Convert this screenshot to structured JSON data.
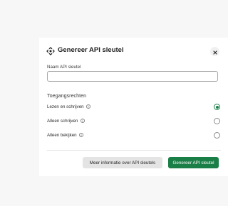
{
  "dialog": {
    "title": "Genereer API sleutel",
    "header_icon": "api-key-move-icon",
    "close_icon": "close-icon",
    "name_field": {
      "label": "Naam API sleutel",
      "value": "",
      "placeholder": ""
    },
    "permissions": {
      "title": "Toegangsrechten",
      "options": [
        {
          "label": "Lezen en schrijven",
          "has_info": true,
          "selected": true
        },
        {
          "label": "Alleen schrijven",
          "has_info": true,
          "selected": false
        },
        {
          "label": "Alleen bekijken",
          "has_info": true,
          "selected": false
        }
      ]
    },
    "buttons": {
      "more_info": "Meer informatie over API sleutels",
      "generate": "Genereer API sleutel"
    }
  },
  "colors": {
    "accent": "#1a7f46",
    "secondary_button": "#e4e4e4",
    "background": "#f7f7f7"
  }
}
